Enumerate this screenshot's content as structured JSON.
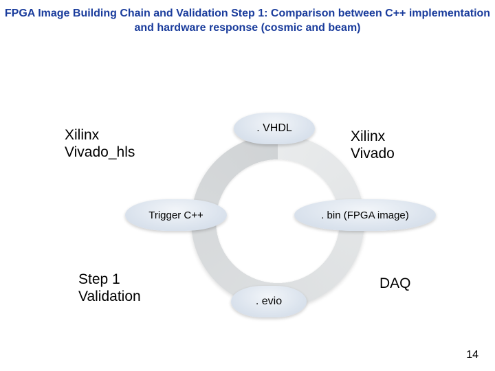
{
  "title": "FPGA Image Building Chain and Validation Step 1: Comparison between C++ implementation and hardware response (cosmic and beam)",
  "cycle": {
    "top": ". VHDL",
    "left": "Trigger C++",
    "right": ". bin (FPGA image)",
    "bottom": ". evio"
  },
  "labels": {
    "xhls": "Xilinx\nVivado_hls",
    "xvivado": "Xilinx\nVivado",
    "step1": "Step 1\nValidation",
    "daq": "DAQ"
  },
  "page_number": "14"
}
